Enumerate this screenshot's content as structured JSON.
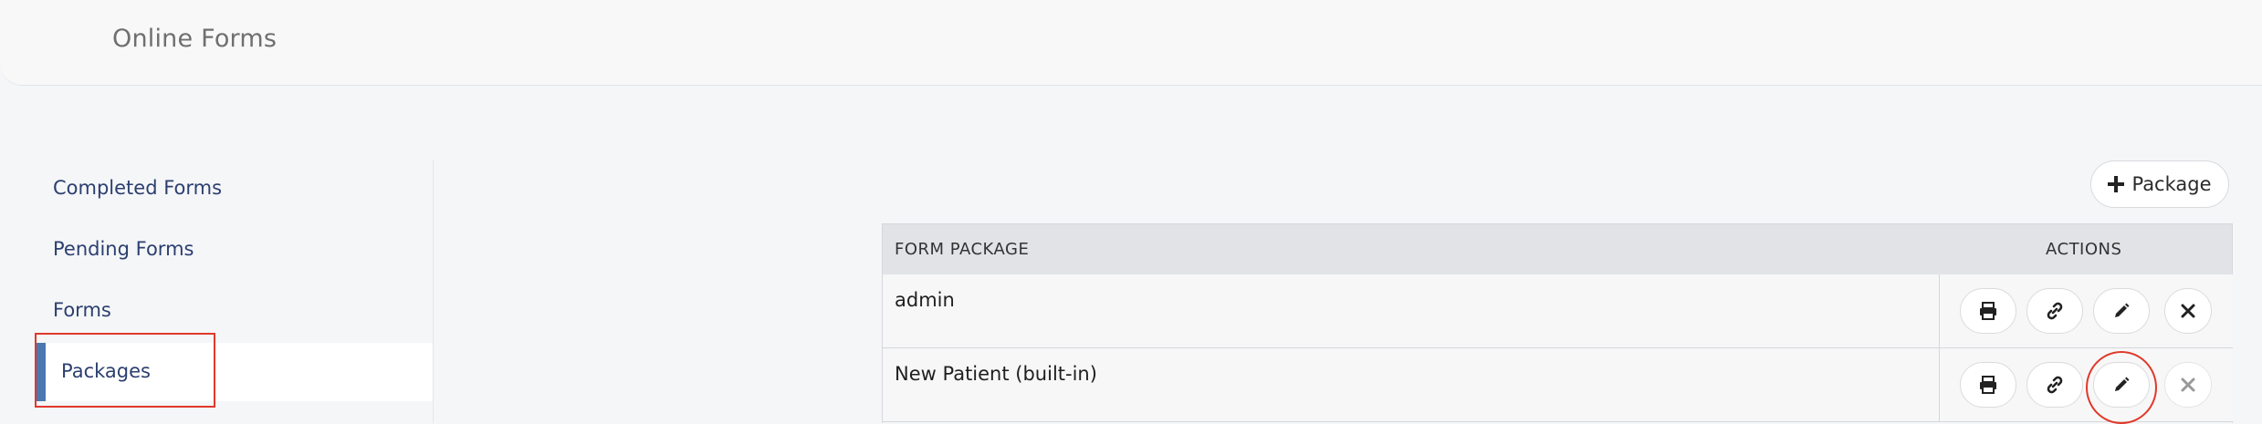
{
  "header": {
    "title": "Online Forms"
  },
  "sidebar": {
    "items": [
      {
        "label": "Completed Forms"
      },
      {
        "label": "Pending Forms"
      },
      {
        "label": "Forms"
      },
      {
        "label": "Packages",
        "active": true
      }
    ]
  },
  "toolbar": {
    "add_package_label": "Package",
    "add_icon": "plus-icon"
  },
  "table": {
    "columns": [
      "FORM PACKAGE",
      "ACTIONS"
    ],
    "rows": [
      {
        "name": "admin",
        "actions": [
          "print-icon",
          "link-icon",
          "pencil-icon",
          "close-icon"
        ]
      },
      {
        "name": "New Patient (built-in)",
        "actions": [
          "print-icon",
          "link-icon",
          "pencil-icon",
          "close-icon"
        ]
      }
    ]
  },
  "colors": {
    "accent_bar": "#4a78b0",
    "nav_text": "#2b3f6f",
    "annotation_red": "#e0392b"
  }
}
